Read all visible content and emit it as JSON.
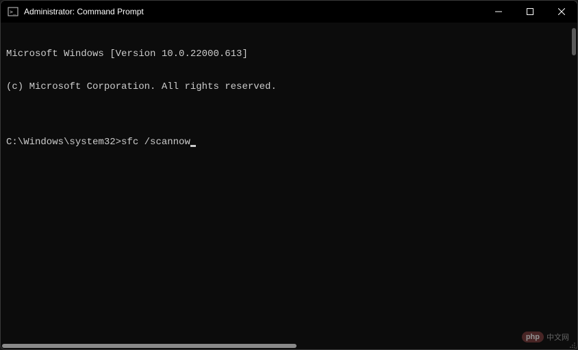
{
  "window": {
    "title": "Administrator: Command Prompt"
  },
  "terminal": {
    "lines": [
      "Microsoft Windows [Version 10.0.22000.613]",
      "(c) Microsoft Corporation. All rights reserved.",
      "",
      ""
    ],
    "prompt": "C:\\Windows\\system32>",
    "command": "sfc /scannow"
  },
  "watermark": {
    "badge": "php",
    "text": "中文网"
  }
}
